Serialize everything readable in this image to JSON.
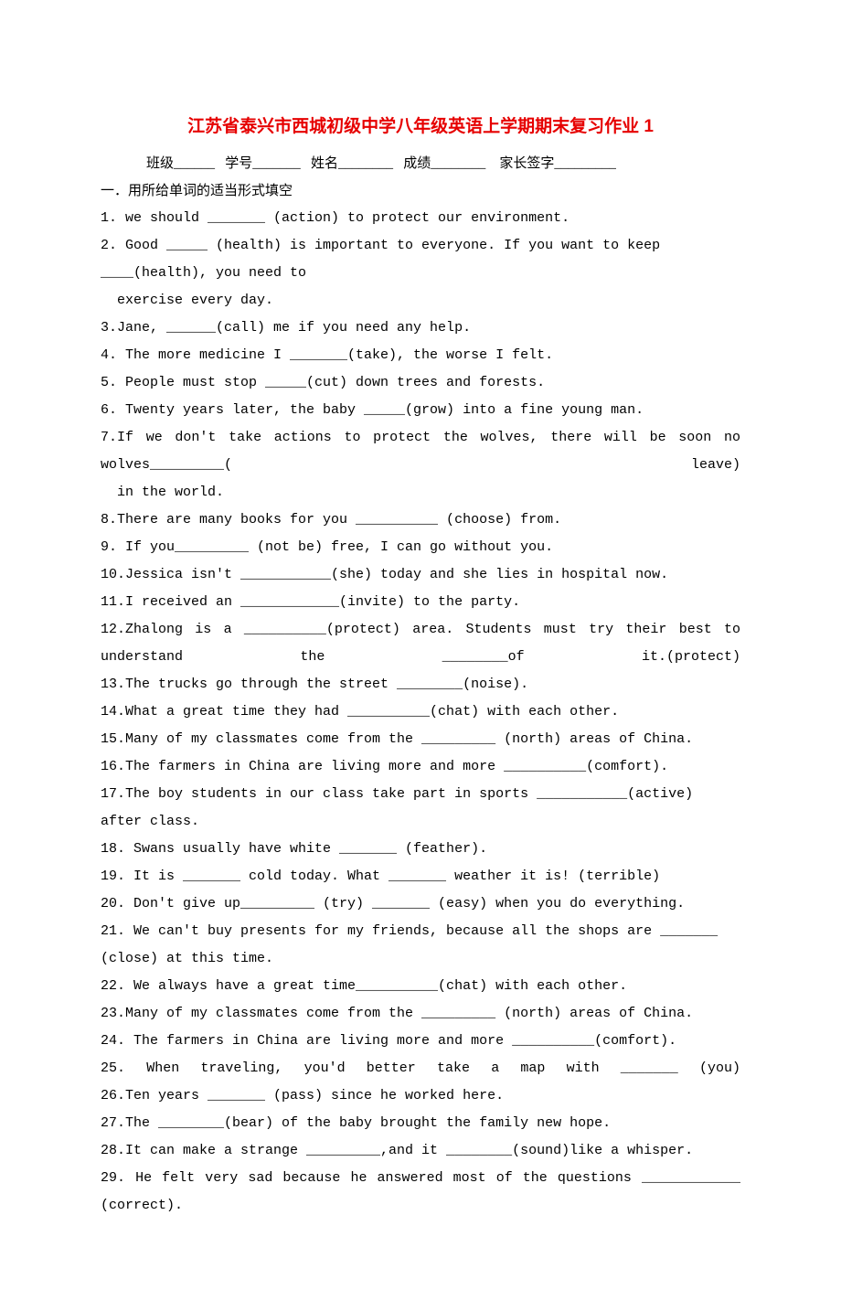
{
  "title": "江苏省泰兴市西城初级中学八年级英语上学期期末复习作业 1",
  "header": {
    "class_label": "班级______",
    "id_label": "学号_______",
    "name_label": "姓名________",
    "score_label": "成绩________",
    "parent_label": "家长签字_________"
  },
  "section1": "一．用所给单词的适当形式填空",
  "q1": "1. we should _______ (action) to protect our environment.",
  "q2a": "2. Good _____ (health) is important to everyone. If you want to keep ____(health), you need to",
  "q2b": "  exercise every day.",
  "q3": "3.Jane, ______(call) me if you need any help.",
  "q4": "4. The more medicine I _______(take), the worse I felt.",
  "q5": "5. People must stop _____(cut) down trees and forests.",
  "q6": "6. Twenty years later, the baby _____(grow) into a fine young man.",
  "q7a": "7.If we don't take actions to protect the wolves, there will be soon no wolves_________( leave)",
  "q7b": "  in the world.",
  "q8": "8.There are many books for you __________ (choose) from.",
  "q9": "9. If you_________ (not be) free, I can go without you.",
  "q10": "10.Jessica isn't ___________(she) today and she lies in hospital now.",
  "q11": "11.I received an ____________(invite) to the party.",
  "q12": "12.Zhalong is a __________(protect) area. Students must try their best to understand the ________of it.(protect)",
  "q13": "13.The trucks go through the street ________(noise).",
  "q14": "14.What a great time they had __________(chat) with each other.",
  "q15": "15.Many of my classmates come from the _________ (north) areas of China.",
  "q16": "16.The farmers in China are living more and more __________(comfort).",
  "q17": "17.The boy students in our class take part in sports ___________(active) after class.",
  "q18": "18. Swans usually have white _______ (feather).",
  "q19": "19. It is _______ cold today. What _______ weather it is! (terrible)",
  "q20": "20. Don't give up_________ (try) _______ (easy) when you do everything.",
  "q21": "21. We can't buy presents for my friends, because all the shops are _______ (close) at this time.",
  "q22": "22. We always have a great time__________(chat) with each other.",
  "q23": "23.Many of my classmates come from the _________ (north) areas of China.",
  "q24": "24. The farmers in China are living more and more __________(comfort).",
  "q25": "25. When traveling, you'd better take a map with _______ (you)",
  "q26": "26.Ten years _______ (pass) since he worked here.",
  "q27": "27.The ________(bear) of the baby brought the family new hope.",
  "q28": "28.It can make a strange _________,and it ________(sound)like a whisper.",
  "q29": "29. He felt very sad because he answered most of the questions ____________ (correct)."
}
